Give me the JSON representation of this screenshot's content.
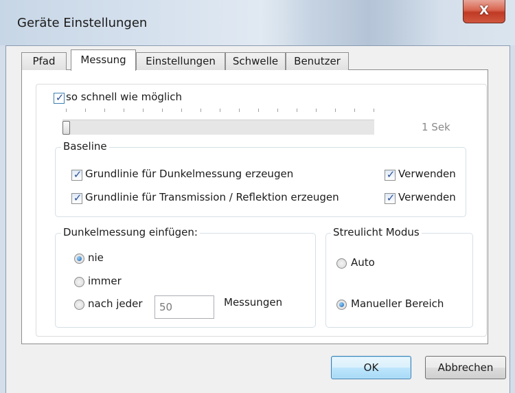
{
  "window": {
    "title": "Geräte Einstellungen",
    "close_label": "X"
  },
  "tabs": [
    {
      "label": "Pfad"
    },
    {
      "label": "Messung"
    },
    {
      "label": "Einstellungen"
    },
    {
      "label": "Schwelle"
    },
    {
      "label": "Benutzer"
    }
  ],
  "measurement": {
    "fast_checkbox_label": "so schnell wie möglich",
    "fast_checked": true,
    "slider_value_label": "1 Sek"
  },
  "baseline": {
    "title": "Baseline",
    "dark_label": "Grundlinie für Dunkelmessung erzeugen",
    "trans_label": "Grundlinie für Transmission / Reflektion erzeugen",
    "use_label_1": "Verwenden",
    "use_label_2": "Verwenden"
  },
  "dark_insert": {
    "title": "Dunkelmessung einfügen:",
    "option_never": "nie",
    "option_always": "immer",
    "option_after": "nach jeder",
    "after_value": "50",
    "after_unit": "Messungen",
    "selected": "nie"
  },
  "scatter": {
    "title": "Streulicht Modus",
    "option_auto": "Auto",
    "option_manual": "Manueller Bereich",
    "selected": "Manueller Bereich"
  },
  "buttons": {
    "ok": "OK",
    "cancel": "Abbrechen"
  },
  "colors": {
    "accent": "#3c7fb1",
    "close": "#c94b35"
  }
}
